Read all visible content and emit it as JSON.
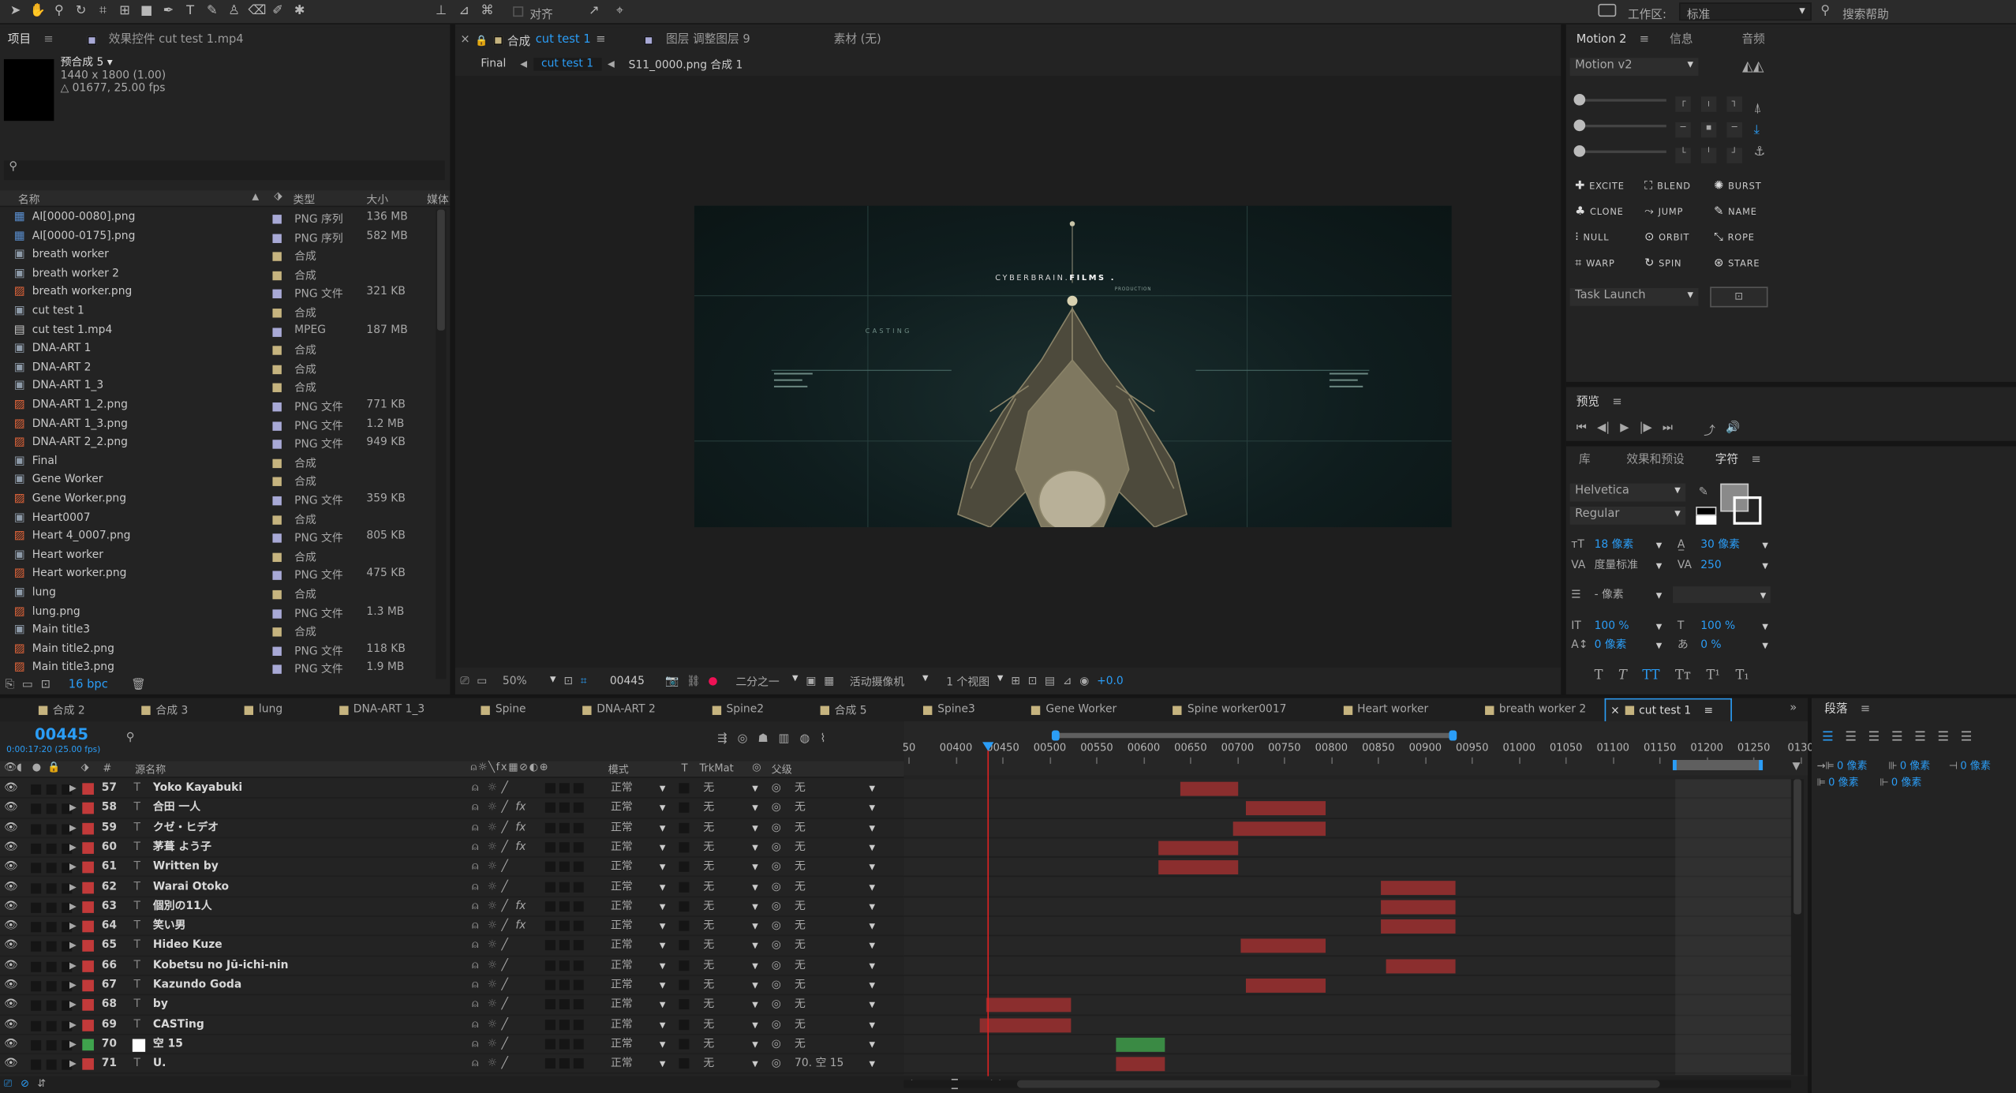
{
  "toolbar": {
    "align_label": "对齐",
    "workspace_label": "工作区:",
    "workspace_value": "标准",
    "search_help": "搜索帮助"
  },
  "project_panel": {
    "tabs": [
      "项目",
      "效果控件 cut test 1.mp4"
    ],
    "preview_name": "预合成 5 ▾",
    "preview_size": "1440 x 1800 (1.00)",
    "preview_dur": "△ 01677, 25.00 fps",
    "columns": [
      "名称",
      "类型",
      "大小",
      "媒体"
    ],
    "items": [
      {
        "name": "AI[0000-0080].png",
        "type": "PNG 序列",
        "size": "136 MB",
        "color": "#a8a9d6",
        "icon": "sequence-icon"
      },
      {
        "name": "AI[0000-0175].png",
        "type": "PNG 序列",
        "size": "582 MB",
        "color": "#a8a9d6",
        "icon": "sequence-icon"
      },
      {
        "name": "breath worker",
        "type": "合成",
        "size": "",
        "color": "#c6b47f",
        "icon": "composition-icon"
      },
      {
        "name": "breath worker 2",
        "type": "合成",
        "size": "",
        "color": "#c6b47f",
        "icon": "composition-icon"
      },
      {
        "name": "breath worker.png",
        "type": "PNG 文件",
        "size": "321 KB",
        "color": "#a8a9d6",
        "icon": "image-icon"
      },
      {
        "name": "cut test 1",
        "type": "合成",
        "size": "",
        "color": "#c6b47f",
        "icon": "composition-icon"
      },
      {
        "name": "cut test 1.mp4",
        "type": "MPEG",
        "size": "187 MB",
        "color": "#a8a9d6",
        "icon": "video-icon"
      },
      {
        "name": "DNA-ART 1",
        "type": "合成",
        "size": "",
        "color": "#c6b47f",
        "icon": "composition-icon"
      },
      {
        "name": "DNA-ART 2",
        "type": "合成",
        "size": "",
        "color": "#c6b47f",
        "icon": "composition-icon"
      },
      {
        "name": "DNA-ART 1_3",
        "type": "合成",
        "size": "",
        "color": "#c6b47f",
        "icon": "composition-icon"
      },
      {
        "name": "DNA-ART 1_2.png",
        "type": "PNG 文件",
        "size": "771 KB",
        "color": "#a8a9d6",
        "icon": "image-icon"
      },
      {
        "name": "DNA-ART 1_3.png",
        "type": "PNG 文件",
        "size": "1.2 MB",
        "color": "#a8a9d6",
        "icon": "image-icon"
      },
      {
        "name": "DNA-ART 2_2.png",
        "type": "PNG 文件",
        "size": "949 KB",
        "color": "#a8a9d6",
        "icon": "image-icon"
      },
      {
        "name": "Final",
        "type": "合成",
        "size": "",
        "color": "#c6b47f",
        "icon": "composition-icon"
      },
      {
        "name": "Gene Worker",
        "type": "合成",
        "size": "",
        "color": "#c6b47f",
        "icon": "composition-icon"
      },
      {
        "name": "Gene Worker.png",
        "type": "PNG 文件",
        "size": "359 KB",
        "color": "#a8a9d6",
        "icon": "image-icon"
      },
      {
        "name": "Heart0007",
        "type": "合成",
        "size": "",
        "color": "#c6b47f",
        "icon": "composition-icon"
      },
      {
        "name": "Heart 4_0007.png",
        "type": "PNG 文件",
        "size": "805 KB",
        "color": "#a8a9d6",
        "icon": "image-icon"
      },
      {
        "name": "Heart worker",
        "type": "合成",
        "size": "",
        "color": "#c6b47f",
        "icon": "composition-icon"
      },
      {
        "name": "Heart worker.png",
        "type": "PNG 文件",
        "size": "475 KB",
        "color": "#a8a9d6",
        "icon": "image-icon"
      },
      {
        "name": "lung",
        "type": "合成",
        "size": "",
        "color": "#c6b47f",
        "icon": "composition-icon"
      },
      {
        "name": "lung.png",
        "type": "PNG 文件",
        "size": "1.3 MB",
        "color": "#a8a9d6",
        "icon": "image-icon"
      },
      {
        "name": "Main title3",
        "type": "合成",
        "size": "",
        "color": "#c6b47f",
        "icon": "composition-icon"
      },
      {
        "name": "Main title2.png",
        "type": "PNG 文件",
        "size": "118 KB",
        "color": "#a8a9d6",
        "icon": "image-icon"
      },
      {
        "name": "Main title3.png",
        "type": "PNG 文件",
        "size": "1.9 MB",
        "color": "#a8a9d6",
        "icon": "image-icon"
      }
    ],
    "bpc": "16 bpc"
  },
  "comp_panel": {
    "tabs": [
      "合成",
      "cut test 1",
      "图层 调整图层 9",
      "素材 (无)"
    ],
    "breadcrumbs": [
      "Final",
      "cut test 1",
      "S11_0000.png 合成 1"
    ],
    "viewer": {
      "brand_a": "CYBERBRAIN.",
      "brand_b": "FILMS .",
      "brand_c": "PRODUCTION",
      "casting": "CASTING"
    },
    "footer": {
      "zoom": "50%",
      "timecode": "00445",
      "resolution": "二分之一",
      "camera": "活动摄像机",
      "views": "1 个视图",
      "exposure": "+0.0"
    }
  },
  "motion_panel": {
    "tabs": [
      "Motion 2",
      "信息",
      "音频"
    ],
    "version": "Motion v2",
    "buttons": [
      "EXCITE",
      "BLEND",
      "BURST",
      "CLONE",
      "JUMP",
      "NAME",
      "NULL",
      "ORBIT",
      "ROPE",
      "WARP",
      "SPIN",
      "STARE"
    ],
    "task": "Task Launch"
  },
  "preview_panel": {
    "title": "预览"
  },
  "char_panel": {
    "tabs": [
      "库",
      "效果和预设",
      "字符"
    ],
    "font": "Helvetica",
    "style": "Regular",
    "size": "18 像素",
    "leading": "30 像素",
    "kerning": "度量标准",
    "tracking": "250",
    "stroke": "- 像素",
    "vscale": "100 %",
    "hscale": "100 %",
    "baseline": "0 像素",
    "tsume": "0 %"
  },
  "para_panel": {
    "title": "段落",
    "indent1": "0 像素",
    "indent2": "0 像素",
    "indent3": "0 像素",
    "space1": "0 像素",
    "space2": "0 像素"
  },
  "timeline": {
    "tabs": [
      "合成 2",
      "合成 3",
      "lung",
      "DNA-ART 1_3",
      "Spine",
      "DNA-ART 2",
      "Spine2",
      "合成 5",
      "Spine3",
      "Gene Worker",
      "Spine worker0017",
      "Heart worker",
      "breath worker 2",
      "cut test 1"
    ],
    "timecode": "00445",
    "timecode_sub": "0:00:17:20 (25.00 fps)",
    "columns": {
      "source": "源名称",
      "mode": "模式",
      "t": "T",
      "trkmat": "TrkMat",
      "parent": "父级"
    },
    "ruler": [
      "50",
      "00400",
      "00450",
      "00500",
      "00550",
      "00600",
      "00650",
      "00700",
      "00750",
      "00800",
      "00850",
      "00900",
      "00950",
      "01000",
      "01050",
      "01100",
      "01150",
      "01200",
      "01250",
      "0130"
    ],
    "layers": [
      {
        "num": "57",
        "label": "#c23a3a",
        "name": "Yoko Kayabuki",
        "fx": false,
        "mode": "正常",
        "trk": "无",
        "parent": "无",
        "bar": [
          918,
          963
        ],
        "bar_color": "#8b2e2e"
      },
      {
        "num": "58",
        "label": "#c23a3a",
        "name": "合田 一人",
        "fx": true,
        "mode": "正常",
        "trk": "无",
        "parent": "无",
        "bar": [
          969,
          1031
        ],
        "bar_color": "#8b2e2e"
      },
      {
        "num": "59",
        "label": "#c23a3a",
        "name": "クゼ・ヒデオ",
        "fx": true,
        "mode": "正常",
        "trk": "无",
        "parent": "无",
        "bar": [
          959,
          1031
        ],
        "bar_color": "#8b2e2e"
      },
      {
        "num": "60",
        "label": "#c23a3a",
        "name": "茅葺 よう子",
        "fx": true,
        "mode": "正常",
        "trk": "无",
        "parent": "无",
        "bar": [
          901,
          963
        ],
        "bar_color": "#8b2e2e"
      },
      {
        "num": "61",
        "label": "#c23a3a",
        "name": "Written by",
        "fx": false,
        "mode": "正常",
        "trk": "无",
        "parent": "无",
        "bar": [
          901,
          963
        ],
        "bar_color": "#8b2e2e"
      },
      {
        "num": "62",
        "label": "#c23a3a",
        "name": "Warai Otoko",
        "fx": false,
        "mode": "正常",
        "trk": "无",
        "parent": "无",
        "bar": [
          1074,
          1132
        ],
        "bar_color": "#8b2e2e"
      },
      {
        "num": "63",
        "label": "#c23a3a",
        "name": "個別の11人",
        "fx": true,
        "mode": "正常",
        "trk": "无",
        "parent": "无",
        "bar": [
          1074,
          1132
        ],
        "bar_color": "#8b2e2e"
      },
      {
        "num": "64",
        "label": "#c23a3a",
        "name": "笑い男",
        "fx": true,
        "mode": "正常",
        "trk": "无",
        "parent": "无",
        "bar": [
          1074,
          1132
        ],
        "bar_color": "#8b2e2e"
      },
      {
        "num": "65",
        "label": "#c23a3a",
        "name": "Hideo Kuze",
        "fx": false,
        "mode": "正常",
        "trk": "无",
        "parent": "无",
        "bar": [
          965,
          1031
        ],
        "bar_color": "#8b2e2e"
      },
      {
        "num": "66",
        "label": "#c23a3a",
        "name": "Kobetsu no Jū-ichi-nin",
        "fx": false,
        "mode": "正常",
        "trk": "无",
        "parent": "无",
        "bar": [
          1078,
          1132
        ],
        "bar_color": "#8b2e2e"
      },
      {
        "num": "67",
        "label": "#c23a3a",
        "name": "Kazundo Goda",
        "fx": false,
        "mode": "正常",
        "trk": "无",
        "parent": "无",
        "bar": [
          969,
          1031
        ],
        "bar_color": "#8b2e2e"
      },
      {
        "num": "68",
        "label": "#c23a3a",
        "name": "by",
        "fx": false,
        "mode": "正常",
        "trk": "无",
        "parent": "无",
        "bar": [
          767,
          833
        ],
        "bar_color": "#8b2e2e"
      },
      {
        "num": "69",
        "label": "#c23a3a",
        "name": "CASTing",
        "fx": false,
        "mode": "正常",
        "trk": "无",
        "parent": "无",
        "bar": [
          762,
          833
        ],
        "bar_color": "#8b2e2e"
      },
      {
        "num": "70",
        "label": "#3fa34d",
        "name": "空 15",
        "fx": false,
        "mode": "正常",
        "trk": "无",
        "parent": "无",
        "bar": [
          868,
          906
        ],
        "bar_color": "#3a8a44"
      },
      {
        "num": "71",
        "label": "#c23a3a",
        "name": "U.",
        "fx": false,
        "mode": "正常",
        "trk": "无",
        "parent": "70. 空 15",
        "bar": [
          868,
          906
        ],
        "bar_color": "#8b2e2e"
      }
    ]
  }
}
